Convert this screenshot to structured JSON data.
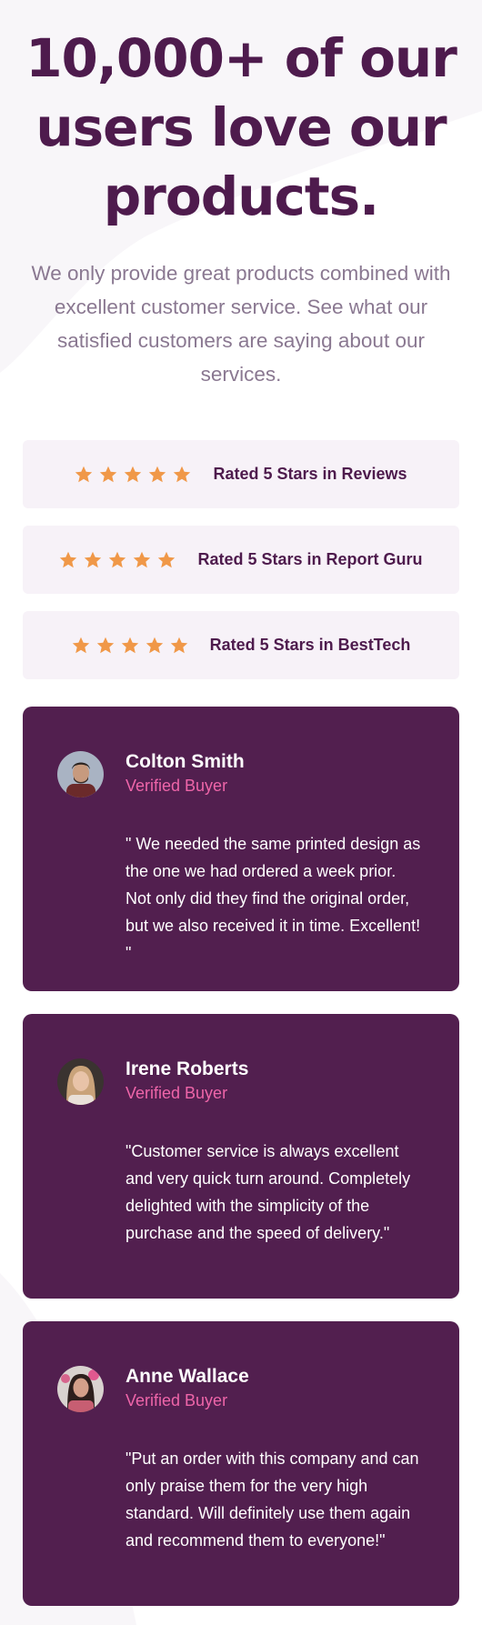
{
  "hero": {
    "title_line1": "10,000+ of our",
    "title_line2": "users love our",
    "title_line3": "products.",
    "description": "We only provide great products combined with excellent customer service. See what our satisfied customers are saying about our services."
  },
  "ratings": [
    {
      "label": "Rated 5 Stars in Reviews",
      "stars": 5
    },
    {
      "label": "Rated 5 Stars in Report Guru",
      "stars": 5
    },
    {
      "label": "Rated 5 Stars in BestTech",
      "stars": 5
    }
  ],
  "testimonials": [
    {
      "name": "Colton Smith",
      "role": "Verified Buyer",
      "quote": "\" We needed the same printed design as the one we had ordered a week prior. Not only did they find the original order, but we also received it in time. Excellent! \""
    },
    {
      "name": "Irene Roberts",
      "role": "Verified Buyer",
      "quote": "\"Customer service is always excellent and very quick turn around. Completely delighted with the simplicity of the purchase and the speed of delivery.\""
    },
    {
      "name": "Anne Wallace",
      "role": "Verified Buyer",
      "quote": "\"Put an order with this company and can only praise them for the very high standard. Will definitely use them again and recommend them to everyone!\""
    }
  ],
  "colors": {
    "primary": "#4e1b4d",
    "card_bg": "#521f4f",
    "accent_pink": "#ee65a9",
    "star": "#f09848",
    "rating_bg": "#f7f2f8",
    "muted_text": "#8a7891"
  }
}
